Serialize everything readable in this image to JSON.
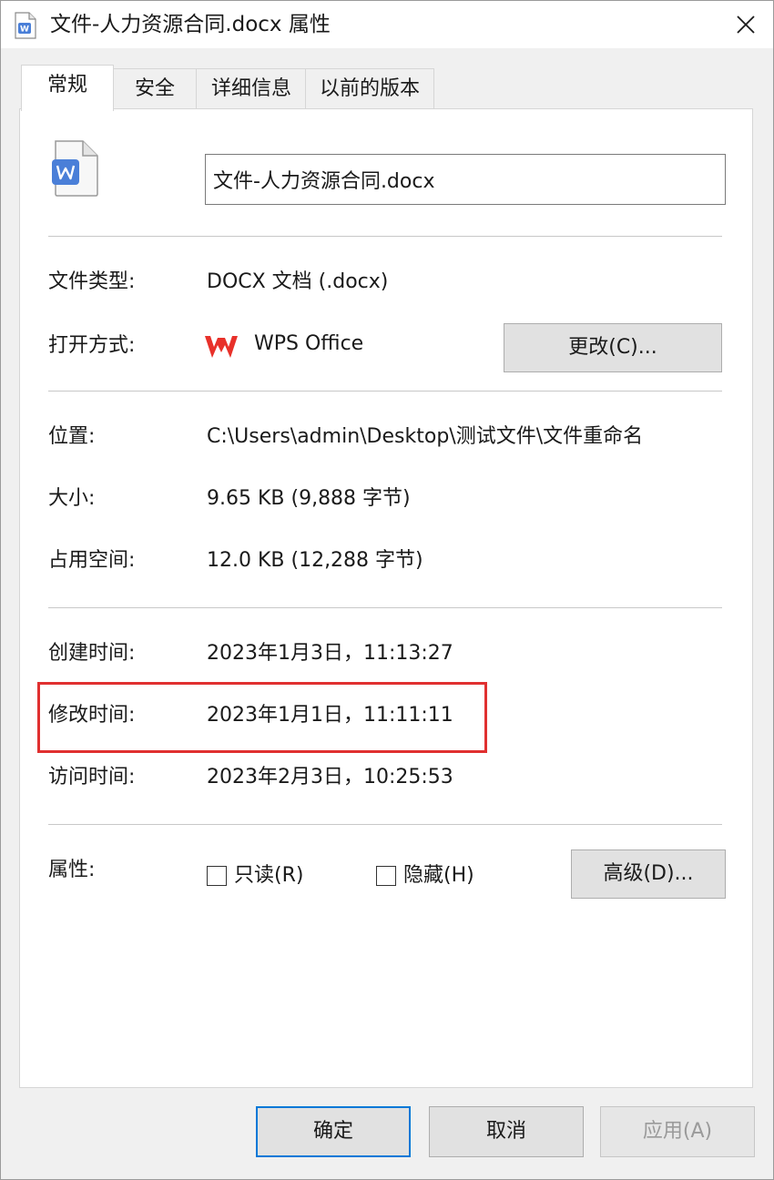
{
  "window": {
    "title": "文件-人力资源合同.docx 属性",
    "file_icon": "word-doc-icon",
    "close_icon": "close-icon"
  },
  "tabs": [
    {
      "label": "常规",
      "active": true
    },
    {
      "label": "安全",
      "active": false
    },
    {
      "label": "详细信息",
      "active": false
    },
    {
      "label": "以前的版本",
      "active": false
    }
  ],
  "general": {
    "file_name": "文件-人力资源合同.docx",
    "file_type_label": "文件类型:",
    "file_type_value": "DOCX 文档 (.docx)",
    "open_with_label": "打开方式:",
    "open_with_app": "WPS Office",
    "open_with_icon": "wps-logo-icon",
    "change_button": "更改(C)...",
    "location_label": "位置:",
    "location_value": "C:\\Users\\admin\\Desktop\\测试文件\\文件重命名",
    "size_label": "大小:",
    "size_value": "9.65 KB (9,888 字节)",
    "size_on_disk_label": "占用空间:",
    "size_on_disk_value": "12.0 KB (12,288 字节)",
    "created_label": "创建时间:",
    "created_value": "2023年1月3日，11:13:27",
    "modified_label": "修改时间:",
    "modified_value": "2023年1月1日，11:11:11",
    "accessed_label": "访问时间:",
    "accessed_value": "2023年2月3日，10:25:53",
    "attributes_label": "属性:",
    "readonly_label": "只读(R)",
    "readonly_checked": false,
    "hidden_label": "隐藏(H)",
    "hidden_checked": false,
    "advanced_button": "高级(D)..."
  },
  "footer": {
    "ok_button": "确定",
    "cancel_button": "取消",
    "apply_button": "应用(A)"
  },
  "colors": {
    "highlight_border": "#e03030",
    "primary_button_border": "#0078d7",
    "wps_red": "#e8312a",
    "word_blue": "#4a7fd8"
  }
}
